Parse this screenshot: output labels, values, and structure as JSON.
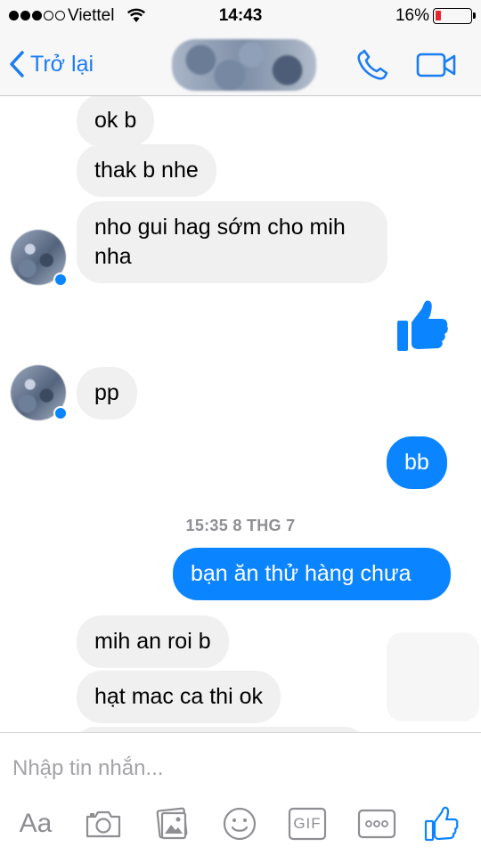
{
  "status_bar": {
    "carrier": "Viettel",
    "time": "14:43",
    "battery": "16%"
  },
  "nav": {
    "back_label": "Trở lại",
    "icons": [
      "chevron-left-icon",
      "phone-icon",
      "video-camera-icon"
    ]
  },
  "messages": [
    {
      "side": "in",
      "text": "ok b"
    },
    {
      "side": "in",
      "text": "thak b nhe"
    },
    {
      "side": "in",
      "lines": [
        "nho gui hag sớm cho mih",
        "nha"
      ]
    },
    {
      "side": "out",
      "sticker": "thumbs-up"
    },
    {
      "side": "in",
      "text": "pp"
    },
    {
      "side": "out",
      "text": "bb"
    },
    {
      "side": "out",
      "text": "bạn ăn thử hàng chưa"
    },
    {
      "side": "in",
      "text": "mih an roi b"
    },
    {
      "side": "in",
      "text": "hạt mac ca thi ok"
    }
  ],
  "timestamp": "15:35 8 THG 7",
  "composer": {
    "placeholder": "Nhập tin nhắn...",
    "text_format_label": "Aa",
    "gif_label": "GIF",
    "icons": [
      "camera-icon",
      "gallery-icon",
      "emoji-icon",
      "gif-icon",
      "more-icon",
      "thumbs-up-icon"
    ]
  },
  "colors": {
    "accent": "#0b84ff",
    "incoming_bubble": "#f1f0f0",
    "battery_low": "#e8272a"
  }
}
